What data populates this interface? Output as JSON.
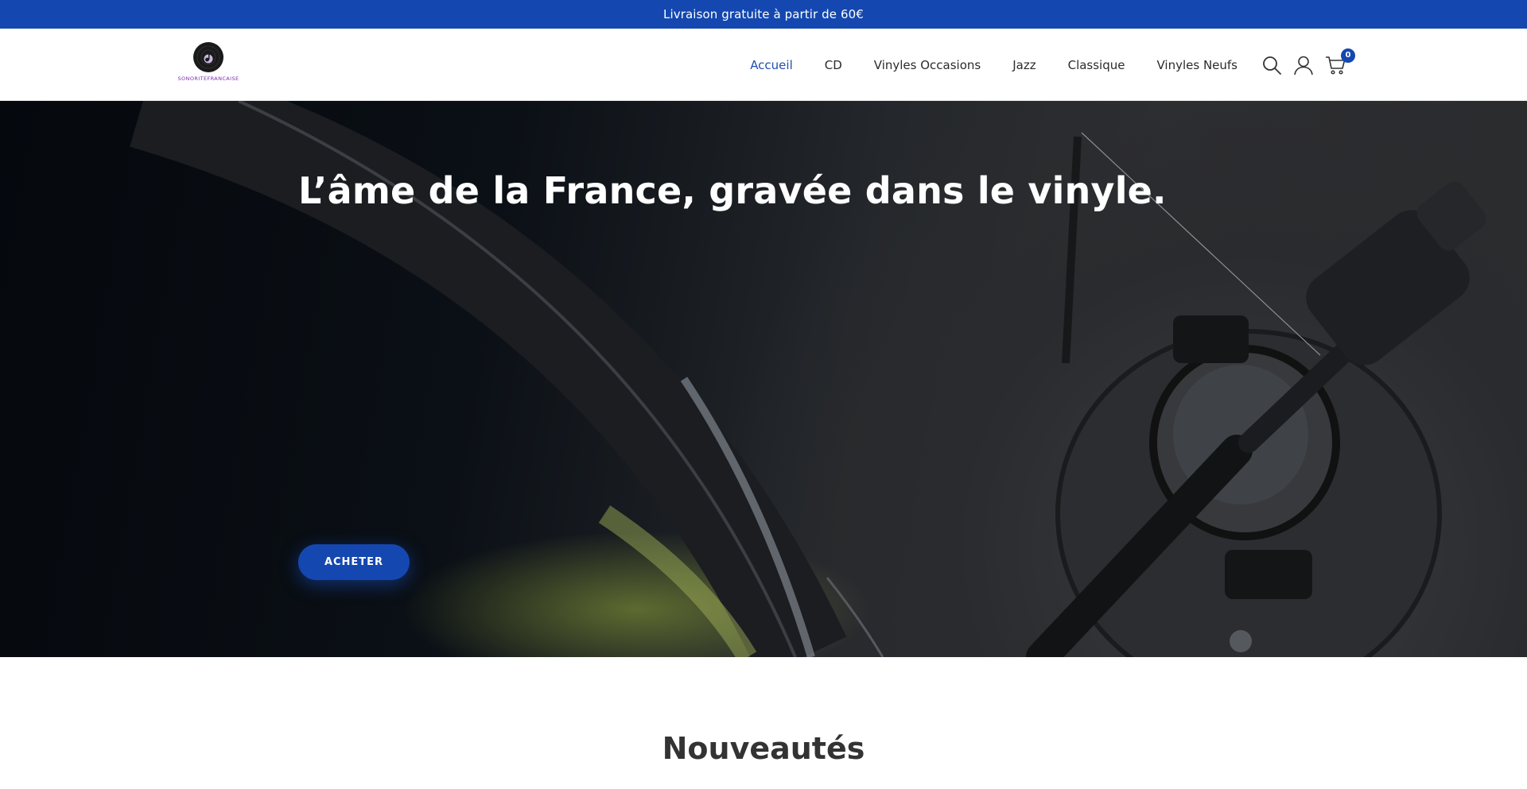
{
  "announcement": {
    "text": "Livraison gratuite à partir de 60€"
  },
  "header": {
    "logo_text": "SONORITEFRANCAISE",
    "nav": [
      {
        "label": "Accueil",
        "active": true
      },
      {
        "label": "CD",
        "active": false
      },
      {
        "label": "Vinyles Occasions",
        "active": false
      },
      {
        "label": "Jazz",
        "active": false
      },
      {
        "label": "Classique",
        "active": false
      },
      {
        "label": "Vinyles Neufs",
        "active": false
      }
    ],
    "icons": [
      "search-icon",
      "account-icon",
      "cart-icon"
    ],
    "cart_count": "0"
  },
  "hero": {
    "title": "L’âme de la France, gravée dans le vinyle.",
    "button_label": "ACHETER"
  },
  "section": {
    "title": "Nouveautés"
  },
  "colors": {
    "brand": "#1448b0",
    "active_link": "#1f4fb0",
    "logo_text": "#7b2fb0"
  }
}
